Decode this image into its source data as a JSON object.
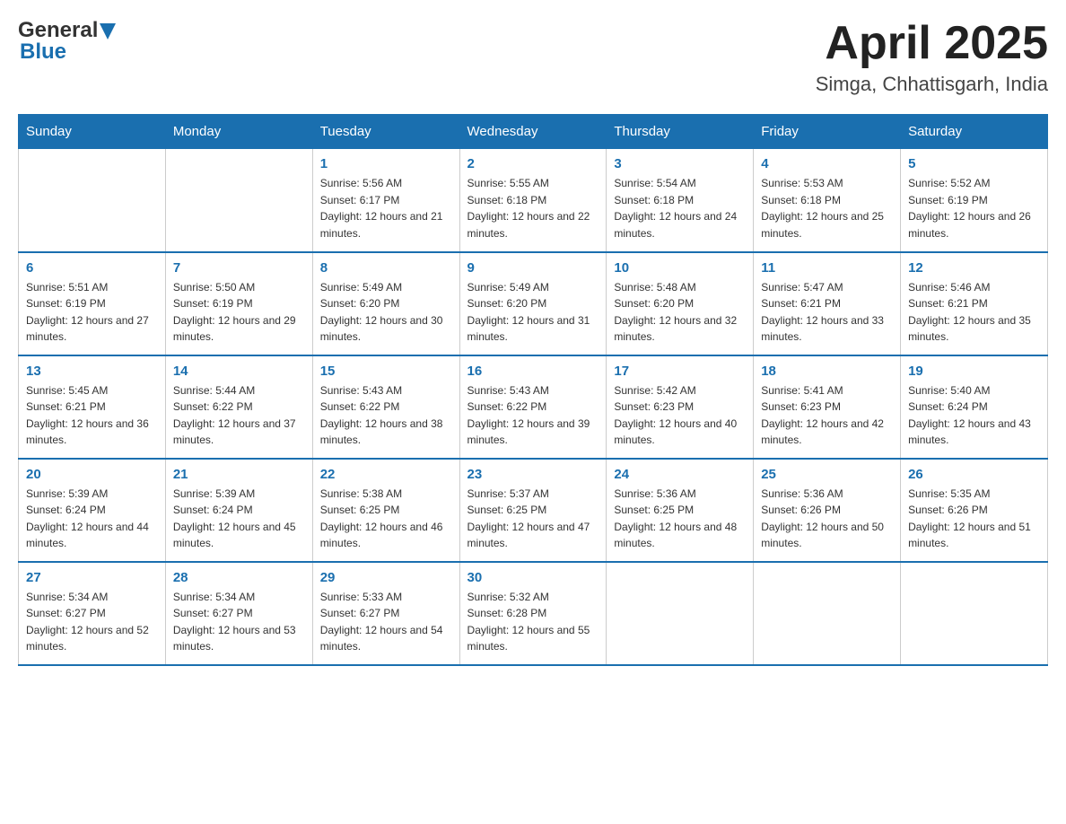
{
  "header": {
    "logo_general": "General",
    "logo_blue": "Blue",
    "month_title": "April 2025",
    "location": "Simga, Chhattisgarh, India"
  },
  "weekdays": [
    "Sunday",
    "Monday",
    "Tuesday",
    "Wednesday",
    "Thursday",
    "Friday",
    "Saturday"
  ],
  "weeks": [
    [
      {
        "day": "",
        "sunrise": "",
        "sunset": "",
        "daylight": ""
      },
      {
        "day": "",
        "sunrise": "",
        "sunset": "",
        "daylight": ""
      },
      {
        "day": "1",
        "sunrise": "Sunrise: 5:56 AM",
        "sunset": "Sunset: 6:17 PM",
        "daylight": "Daylight: 12 hours and 21 minutes."
      },
      {
        "day": "2",
        "sunrise": "Sunrise: 5:55 AM",
        "sunset": "Sunset: 6:18 PM",
        "daylight": "Daylight: 12 hours and 22 minutes."
      },
      {
        "day": "3",
        "sunrise": "Sunrise: 5:54 AM",
        "sunset": "Sunset: 6:18 PM",
        "daylight": "Daylight: 12 hours and 24 minutes."
      },
      {
        "day": "4",
        "sunrise": "Sunrise: 5:53 AM",
        "sunset": "Sunset: 6:18 PM",
        "daylight": "Daylight: 12 hours and 25 minutes."
      },
      {
        "day": "5",
        "sunrise": "Sunrise: 5:52 AM",
        "sunset": "Sunset: 6:19 PM",
        "daylight": "Daylight: 12 hours and 26 minutes."
      }
    ],
    [
      {
        "day": "6",
        "sunrise": "Sunrise: 5:51 AM",
        "sunset": "Sunset: 6:19 PM",
        "daylight": "Daylight: 12 hours and 27 minutes."
      },
      {
        "day": "7",
        "sunrise": "Sunrise: 5:50 AM",
        "sunset": "Sunset: 6:19 PM",
        "daylight": "Daylight: 12 hours and 29 minutes."
      },
      {
        "day": "8",
        "sunrise": "Sunrise: 5:49 AM",
        "sunset": "Sunset: 6:20 PM",
        "daylight": "Daylight: 12 hours and 30 minutes."
      },
      {
        "day": "9",
        "sunrise": "Sunrise: 5:49 AM",
        "sunset": "Sunset: 6:20 PM",
        "daylight": "Daylight: 12 hours and 31 minutes."
      },
      {
        "day": "10",
        "sunrise": "Sunrise: 5:48 AM",
        "sunset": "Sunset: 6:20 PM",
        "daylight": "Daylight: 12 hours and 32 minutes."
      },
      {
        "day": "11",
        "sunrise": "Sunrise: 5:47 AM",
        "sunset": "Sunset: 6:21 PM",
        "daylight": "Daylight: 12 hours and 33 minutes."
      },
      {
        "day": "12",
        "sunrise": "Sunrise: 5:46 AM",
        "sunset": "Sunset: 6:21 PM",
        "daylight": "Daylight: 12 hours and 35 minutes."
      }
    ],
    [
      {
        "day": "13",
        "sunrise": "Sunrise: 5:45 AM",
        "sunset": "Sunset: 6:21 PM",
        "daylight": "Daylight: 12 hours and 36 minutes."
      },
      {
        "day": "14",
        "sunrise": "Sunrise: 5:44 AM",
        "sunset": "Sunset: 6:22 PM",
        "daylight": "Daylight: 12 hours and 37 minutes."
      },
      {
        "day": "15",
        "sunrise": "Sunrise: 5:43 AM",
        "sunset": "Sunset: 6:22 PM",
        "daylight": "Daylight: 12 hours and 38 minutes."
      },
      {
        "day": "16",
        "sunrise": "Sunrise: 5:43 AM",
        "sunset": "Sunset: 6:22 PM",
        "daylight": "Daylight: 12 hours and 39 minutes."
      },
      {
        "day": "17",
        "sunrise": "Sunrise: 5:42 AM",
        "sunset": "Sunset: 6:23 PM",
        "daylight": "Daylight: 12 hours and 40 minutes."
      },
      {
        "day": "18",
        "sunrise": "Sunrise: 5:41 AM",
        "sunset": "Sunset: 6:23 PM",
        "daylight": "Daylight: 12 hours and 42 minutes."
      },
      {
        "day": "19",
        "sunrise": "Sunrise: 5:40 AM",
        "sunset": "Sunset: 6:24 PM",
        "daylight": "Daylight: 12 hours and 43 minutes."
      }
    ],
    [
      {
        "day": "20",
        "sunrise": "Sunrise: 5:39 AM",
        "sunset": "Sunset: 6:24 PM",
        "daylight": "Daylight: 12 hours and 44 minutes."
      },
      {
        "day": "21",
        "sunrise": "Sunrise: 5:39 AM",
        "sunset": "Sunset: 6:24 PM",
        "daylight": "Daylight: 12 hours and 45 minutes."
      },
      {
        "day": "22",
        "sunrise": "Sunrise: 5:38 AM",
        "sunset": "Sunset: 6:25 PM",
        "daylight": "Daylight: 12 hours and 46 minutes."
      },
      {
        "day": "23",
        "sunrise": "Sunrise: 5:37 AM",
        "sunset": "Sunset: 6:25 PM",
        "daylight": "Daylight: 12 hours and 47 minutes."
      },
      {
        "day": "24",
        "sunrise": "Sunrise: 5:36 AM",
        "sunset": "Sunset: 6:25 PM",
        "daylight": "Daylight: 12 hours and 48 minutes."
      },
      {
        "day": "25",
        "sunrise": "Sunrise: 5:36 AM",
        "sunset": "Sunset: 6:26 PM",
        "daylight": "Daylight: 12 hours and 50 minutes."
      },
      {
        "day": "26",
        "sunrise": "Sunrise: 5:35 AM",
        "sunset": "Sunset: 6:26 PM",
        "daylight": "Daylight: 12 hours and 51 minutes."
      }
    ],
    [
      {
        "day": "27",
        "sunrise": "Sunrise: 5:34 AM",
        "sunset": "Sunset: 6:27 PM",
        "daylight": "Daylight: 12 hours and 52 minutes."
      },
      {
        "day": "28",
        "sunrise": "Sunrise: 5:34 AM",
        "sunset": "Sunset: 6:27 PM",
        "daylight": "Daylight: 12 hours and 53 minutes."
      },
      {
        "day": "29",
        "sunrise": "Sunrise: 5:33 AM",
        "sunset": "Sunset: 6:27 PM",
        "daylight": "Daylight: 12 hours and 54 minutes."
      },
      {
        "day": "30",
        "sunrise": "Sunrise: 5:32 AM",
        "sunset": "Sunset: 6:28 PM",
        "daylight": "Daylight: 12 hours and 55 minutes."
      },
      {
        "day": "",
        "sunrise": "",
        "sunset": "",
        "daylight": ""
      },
      {
        "day": "",
        "sunrise": "",
        "sunset": "",
        "daylight": ""
      },
      {
        "day": "",
        "sunrise": "",
        "sunset": "",
        "daylight": ""
      }
    ]
  ]
}
